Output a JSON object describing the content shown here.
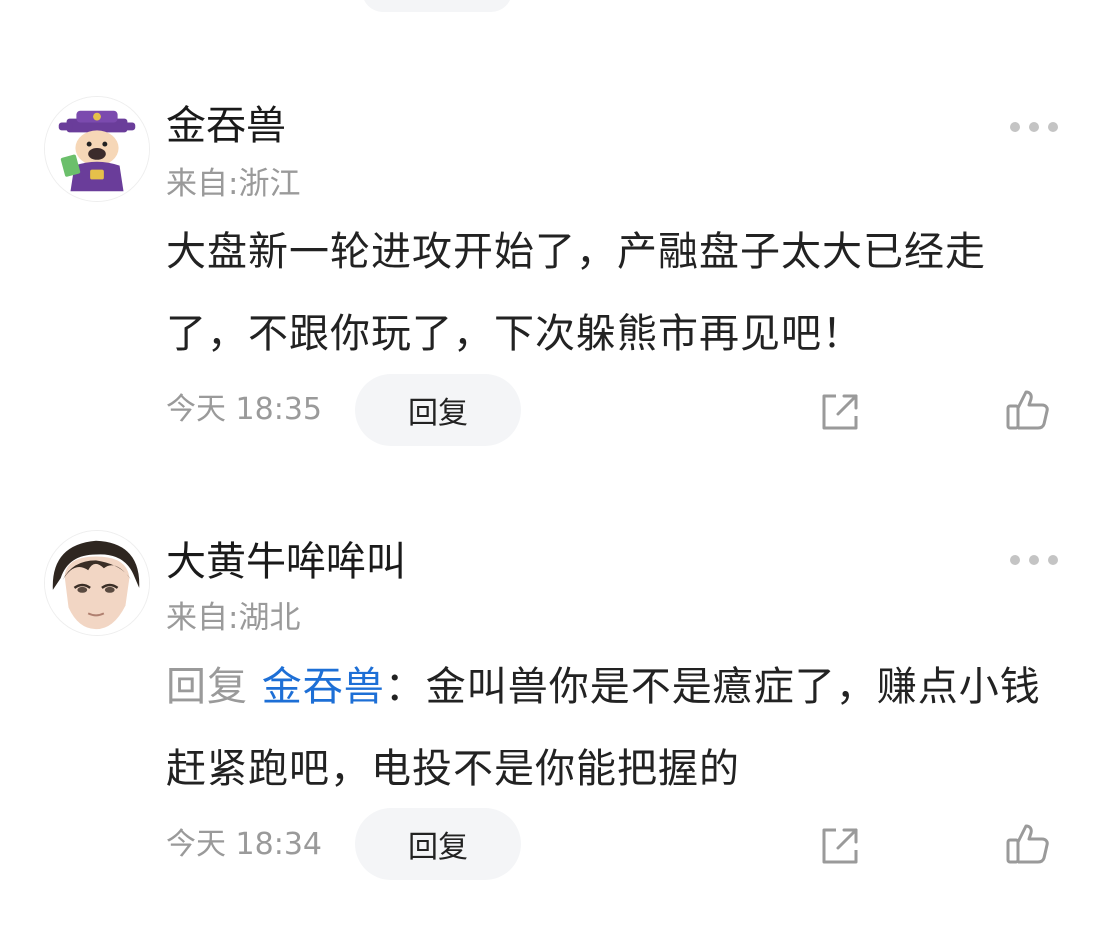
{
  "comments": [
    {
      "username": "金吞兽",
      "location": "来自:浙江",
      "text": "大盘新一轮进攻开始了，产融盘子太大已经走了，不跟你玩了，下次躲熊市再见吧！",
      "time": "今天 18:35",
      "reply_label": "回复"
    },
    {
      "username": "大黄牛哞哞叫",
      "location": "来自:湖北",
      "reply_prefix": "回复",
      "reply_to": "金吞兽",
      "text": "：金叫兽你是不是癔症了，赚点小钱赶紧跑吧，电投不是你能把握的",
      "time": "今天 18:34",
      "reply_label": "回复"
    }
  ],
  "icons": {
    "more": "more-icon",
    "share": "share-icon",
    "like": "thumbs-up-icon"
  },
  "colors": {
    "mention": "#1d6fd6",
    "secondary_text": "#9a9a9a",
    "button_bg": "#f4f5f7"
  }
}
